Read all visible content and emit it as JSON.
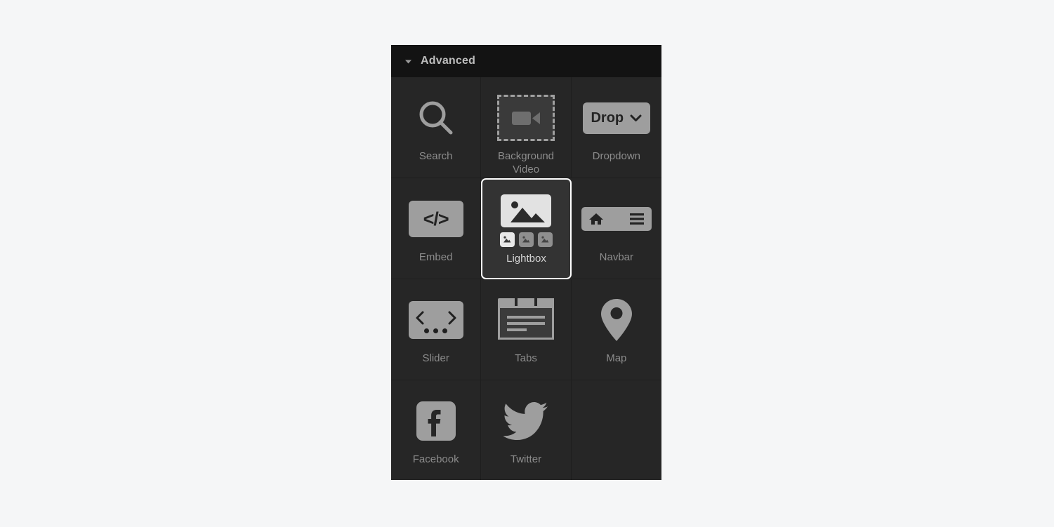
{
  "panel": {
    "title": "Advanced",
    "disclosure_icon": "triangle-down-icon",
    "expanded": true
  },
  "colors": {
    "page_background": "#f5f6f7",
    "panel_background": "#262626",
    "header_background": "#131313",
    "divider": "#1e1e1e",
    "label_text": "#8c8c8c",
    "selected_label_text": "#d4d4d4",
    "selected_border": "#ffffff",
    "icon_gray": "#9e9e9e",
    "icon_light": "#e2e2e2"
  },
  "grid": {
    "columns": 3,
    "rows": 4,
    "items": [
      {
        "label": "Search",
        "icon": "search-icon",
        "name": "search",
        "selected": false
      },
      {
        "label": "Background Video",
        "icon": "background-video-icon",
        "name": "background-video",
        "selected": false
      },
      {
        "label": "Dropdown",
        "icon": "dropdown-icon",
        "name": "dropdown",
        "selected": false,
        "button_text": "Drop"
      },
      {
        "label": "Embed",
        "icon": "embed-code-icon",
        "name": "embed",
        "selected": false,
        "code_text": "</>"
      },
      {
        "label": "Lightbox",
        "icon": "lightbox-icon",
        "name": "lightbox",
        "selected": true,
        "thumbnails": 3,
        "active_thumbnail": 1
      },
      {
        "label": "Navbar",
        "icon": "navbar-icon",
        "name": "navbar",
        "selected": false
      },
      {
        "label": "Slider",
        "icon": "slider-icon",
        "name": "slider",
        "selected": false,
        "dots": 3
      },
      {
        "label": "Tabs",
        "icon": "tabs-icon",
        "name": "tabs",
        "selected": false
      },
      {
        "label": "Map",
        "icon": "map-pin-icon",
        "name": "map",
        "selected": false
      },
      {
        "label": "Facebook",
        "icon": "facebook-icon",
        "name": "facebook",
        "selected": false
      },
      {
        "label": "Twitter",
        "icon": "twitter-icon",
        "name": "twitter",
        "selected": false
      },
      {
        "label": "",
        "icon": "",
        "name": "empty",
        "selected": false
      }
    ]
  }
}
